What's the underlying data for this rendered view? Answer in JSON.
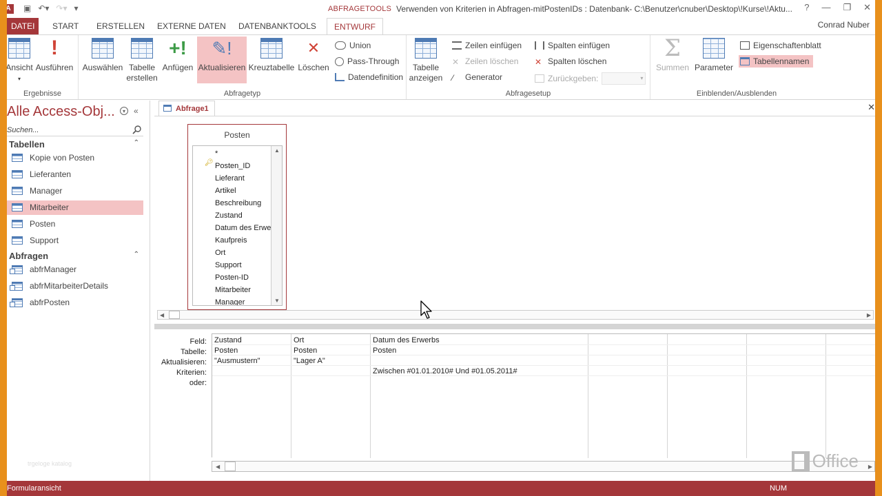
{
  "window": {
    "app_icon": "A",
    "context_tab": "ABFRAGETOOLS",
    "title": "Verwenden von Kriterien in Abfragen-mitPostenIDs : Datenbank- C:\\Benutzer\\cnuber\\Desktop\\!Kurse\\!Aktu...",
    "user": "Conrad Nuber",
    "controls": [
      "?",
      "—",
      "❐",
      "✕"
    ]
  },
  "tabs": [
    "DATEI",
    "START",
    "ERSTELLEN",
    "EXTERNE DATEN",
    "DATENBANKTOOLS",
    "ENTWURF"
  ],
  "ribbon": {
    "ergebnisse": {
      "label": "Ergebnisse",
      "ansicht": "Ansicht",
      "ausfuehren": "Ausführen"
    },
    "abfragetyp": {
      "label": "Abfragetyp",
      "auswaehlen": "Auswählen",
      "tabelle_erstellen_1": "Tabelle",
      "tabelle_erstellen_2": "erstellen",
      "anfuegen": "Anfügen",
      "aktualisieren": "Aktualisieren",
      "kreuztabelle": "Kreuztabelle",
      "loeschen": "Löschen",
      "union": "Union",
      "pass_through": "Pass-Through",
      "datendefinition": "Datendefinition"
    },
    "abfragesetup": {
      "label": "Abfragesetup",
      "tabelle_anzeigen_1": "Tabelle",
      "tabelle_anzeigen_2": "anzeigen",
      "zeilen_einfuegen": "Zeilen einfügen",
      "zeilen_loeschen": "Zeilen löschen",
      "generator": "Generator",
      "spalten_einfuegen": "Spalten einfügen",
      "spalten_loeschen": "Spalten löschen",
      "zurueckgeben": "Zurückgeben:"
    },
    "einblenden": {
      "label": "Einblenden/Ausblenden",
      "summen": "Summen",
      "parameter": "Parameter",
      "eigenschaftenblatt": "Eigenschaftenblatt",
      "tabellennamen": "Tabellennamen"
    }
  },
  "nav": {
    "title": "Alle Access-Obj...",
    "search_placeholder": "Suchen...",
    "sections": [
      {
        "title": "Tabellen",
        "items": [
          "Kopie von Posten",
          "Lieferanten",
          "Manager",
          "Mitarbeiter",
          "Posten",
          "Support"
        ]
      },
      {
        "title": "Abfragen",
        "items": [
          "abfrManager",
          "abfrMitarbeiterDetails",
          "abfrPosten"
        ]
      }
    ],
    "selected": "Mitarbeiter",
    "watermark": "trgeloge katalog"
  },
  "document": {
    "tab": "Abfrage1",
    "table": {
      "name": "Posten",
      "fields": [
        "*",
        "Posten_ID",
        "Lieferant",
        "Artikel",
        "Beschreibung",
        "Zustand",
        "Datum des Erwe",
        "Kaufpreis",
        "Ort",
        "Support",
        "Posten-ID",
        "Mitarbeiter",
        "Manager"
      ]
    },
    "grid": {
      "row_labels": [
        "Feld:",
        "Tabelle:",
        "Aktualisieren:",
        "Kriterien:",
        "oder:"
      ],
      "columns": [
        {
          "feld": "Zustand",
          "tabelle": "Posten",
          "aktualisieren": "\"Ausmustern\"",
          "kriterien": ""
        },
        {
          "feld": "Ort",
          "tabelle": "Posten",
          "aktualisieren": "\"Lager A\"",
          "kriterien": ""
        },
        {
          "feld": "Datum des Erwerbs",
          "tabelle": "Posten",
          "aktualisieren": "",
          "kriterien": "Zwischen #01.01.2010# Und #01.05.2011#"
        }
      ]
    }
  },
  "office_logo": "Office",
  "status": {
    "left": "Formularansicht",
    "num": "NUM"
  }
}
